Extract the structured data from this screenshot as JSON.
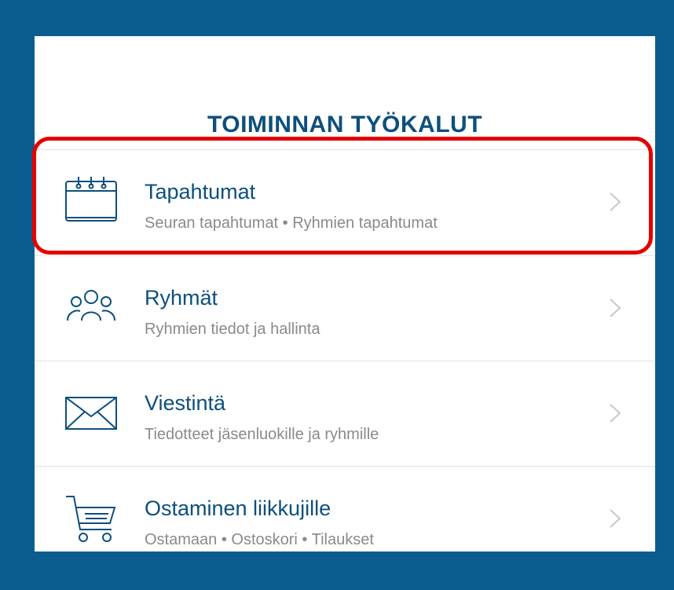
{
  "panel": {
    "title": "TOIMINNAN TYÖKALUT"
  },
  "menu": {
    "items": [
      {
        "label": "Tapahtumat",
        "sub": "Seuran tapahtumat • Ryhmien tapahtumat",
        "icon": "calendar-icon"
      },
      {
        "label": "Ryhmät",
        "sub": "Ryhmien tiedot ja hallinta",
        "icon": "group-icon"
      },
      {
        "label": "Viestintä",
        "sub": "Tiedotteet jäsenluokille ja ryhmille",
        "icon": "envelope-icon"
      },
      {
        "label": "Ostaminen liikkujille",
        "sub": "Ostamaan • Ostoskori • Tilaukset",
        "icon": "shopping-cart-icon"
      }
    ]
  },
  "colors": {
    "background": "#0b5d8f",
    "card": "#ffffff",
    "title": "#0d4f7d",
    "subtext": "#8a8a8a",
    "highlight": "#e30000"
  }
}
